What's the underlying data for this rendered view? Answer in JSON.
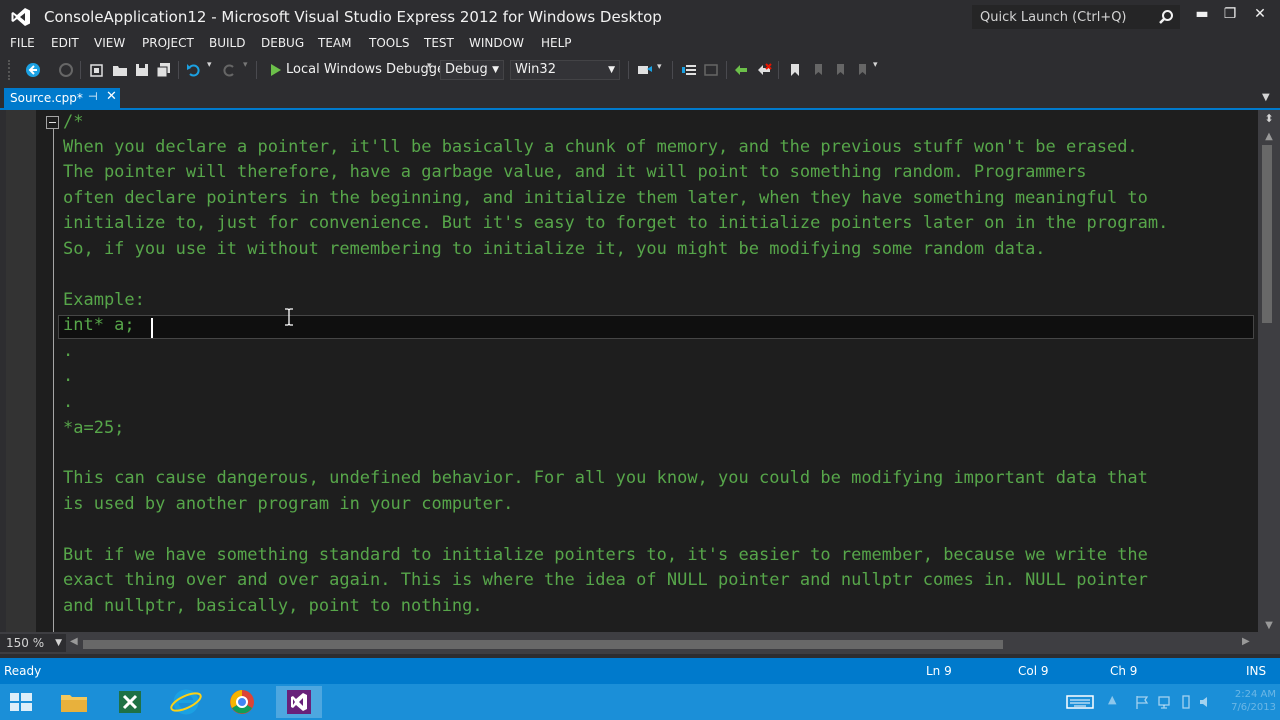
{
  "window": {
    "title": "ConsoleApplication12 - Microsoft Visual Studio Express 2012 for Windows Desktop",
    "quick_launch_placeholder": "Quick Launch (Ctrl+Q)",
    "minimize": "▬",
    "restore": "❐",
    "close": "✕"
  },
  "menu": [
    "FILE",
    "EDIT",
    "VIEW",
    "PROJECT",
    "BUILD",
    "DEBUG",
    "TEAM",
    "TOOLS",
    "TEST",
    "WINDOW",
    "HELP"
  ],
  "toolbar": {
    "debugger_label": "Local Windows Debugger",
    "configuration": "Debug",
    "platform": "Win32"
  },
  "tab": {
    "label": "Source.cpp*",
    "pin": "⊣",
    "close": "✕"
  },
  "editor": {
    "lines": [
      "/*",
      "When you declare a pointer, it'll be basically a chunk of memory, and the previous stuff won't be erased.",
      "The pointer will therefore, have a garbage value, and it will point to something random. Programmers",
      "often declare pointers in the beginning, and initialize them later, when they have something meaningful to",
      "initialize to, just for convenience. But it's easy to forget to initialize pointers later on in the program.",
      "So, if you use it without remembering to initialize it, you might be modifying some random data.",
      "",
      "Example:",
      "int* a; ",
      ".",
      ".",
      ".",
      "*a=25;",
      "",
      "This can cause dangerous, undefined behavior. For all you know, you could be modifying important data that",
      "is used by another program in your computer.",
      "",
      "But if we have something standard to initialize pointers to, it's easier to remember, because we write the",
      "exact thing over and over again. This is where the idea of NULL pointer and nullptr comes in. NULL pointer",
      "and nullptr, basically, point to nothing."
    ],
    "zoom": "150 %"
  },
  "status": {
    "ready": "Ready",
    "ln": "Ln 9",
    "col": "Col 9",
    "ch": "Ch 9",
    "ins": "INS"
  },
  "taskbar": {
    "clock_time": "2:24 AM",
    "clock_date": "7/6/2013"
  },
  "colors": {
    "accent": "#007acc",
    "comment": "#57a64a",
    "editor_bg": "#1e1e1e",
    "chrome_bg": "#2d2d30"
  }
}
